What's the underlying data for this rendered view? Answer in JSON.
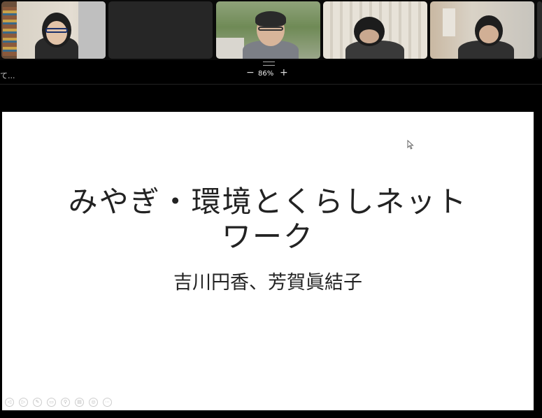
{
  "gallery": {
    "tiles": [
      {
        "name": "participant-1"
      },
      {
        "name": "participant-2-video-off"
      },
      {
        "name": "participant-3"
      },
      {
        "name": "participant-4"
      },
      {
        "name": "participant-5"
      }
    ]
  },
  "zoom_bar": {
    "truncated_name": "て...",
    "minus_label": "−",
    "zoom_level": "86%",
    "plus_label": "+"
  },
  "slide": {
    "title_line1": "みやぎ・環境とくらしネット",
    "title_line2": "ワーク",
    "subtitle": "吉川円香、芳賀眞結子"
  },
  "slide_tools": [
    "◁",
    "▷",
    "✎",
    "▭",
    "⚲",
    "▤",
    "◎",
    "⋯"
  ],
  "colors": {
    "background": "#000000",
    "slide_background": "#ffffff",
    "text": "#222222"
  }
}
